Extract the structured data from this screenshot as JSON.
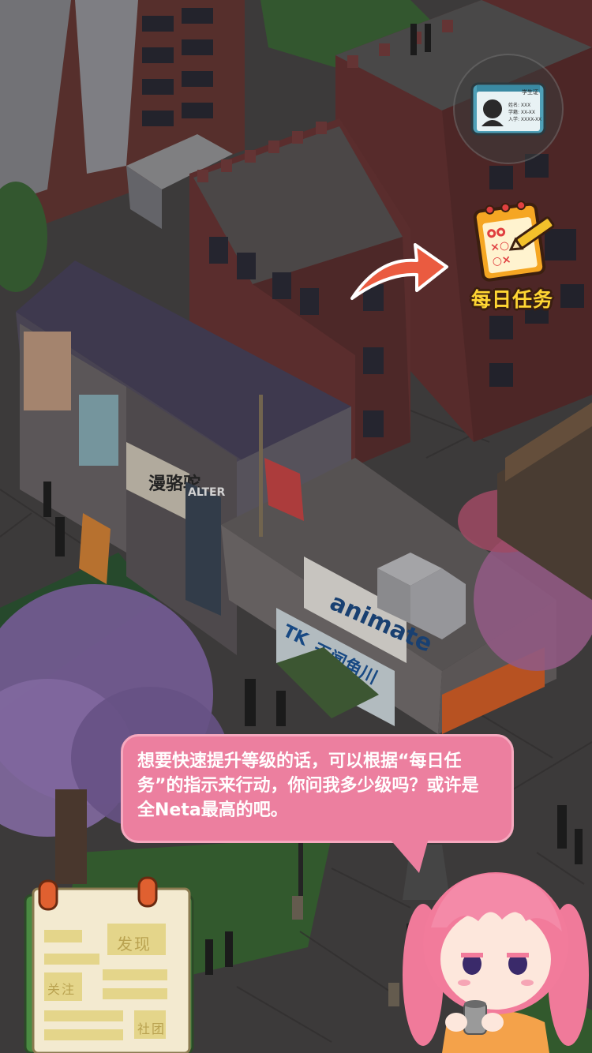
{
  "hud": {
    "id_card": {
      "icon": "student-id-card-icon",
      "title": "学生证",
      "lines": [
        "姓名: XXX",
        "学籍: XX-XX",
        "入学: XXXX-XX"
      ]
    },
    "daily_tasks": {
      "icon": "daily-tasks-clipboard-icon",
      "label": "每日任务"
    }
  },
  "tutorial": {
    "arrow_icon": "pointer-arrow-icon",
    "speech": "想要快速提升等级的话，可以根据“每日任务”的指示来行动，你问我多少级吗？或许是全Neta最高的吧。"
  },
  "guide_board": {
    "labels": [
      "发现",
      "关注",
      "社团"
    ]
  },
  "map_signs": {
    "animate": "animate",
    "tk": "TK",
    "tk_sub": "天闻角川",
    "manluo": "漫骆驼",
    "alter": "ALTER"
  },
  "colors": {
    "bubble": "#ec7f9f",
    "label_yellow": "#ffd633",
    "arrow_red": "#ea5b40"
  }
}
